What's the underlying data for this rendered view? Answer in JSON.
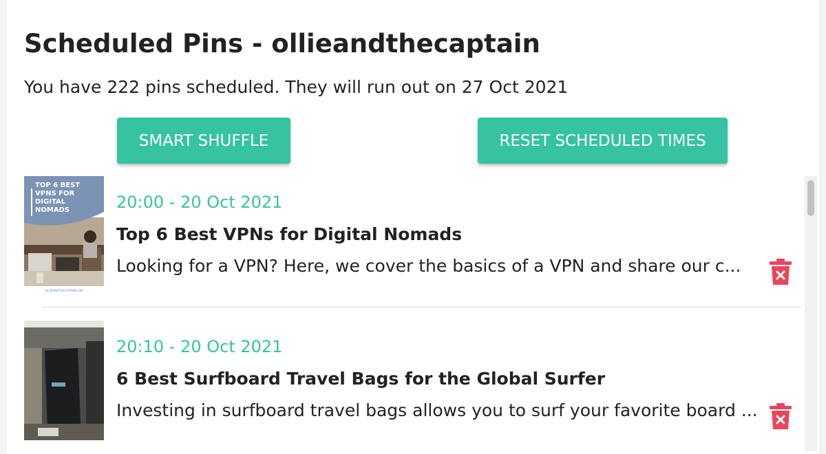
{
  "header": {
    "title": "Scheduled Pins - ollieandthecaptain",
    "subtitle": "You have 222 pins scheduled. They will run out on 27 Oct 2021"
  },
  "actions": {
    "smart_shuffle_label": "SMART SHUFFLE",
    "reset_label": "RESET SCHEDULED TIMES"
  },
  "pins": [
    {
      "time": "20:00 - 20 Oct 2021",
      "title": "Top 6 Best VPNs for Digital Nomads",
      "description": "Looking for a VPN? Here, we cover the basics of a VPN and share our c...",
      "thumbnail": {
        "overlay_lines": [
          "TOP 6 BEST",
          "VPNS FOR",
          "DIGITAL",
          "NOMADS"
        ],
        "footer": "OLLIEANDTHECAPTAIN.COM"
      }
    },
    {
      "time": "20:10 - 20 Oct 2021",
      "title": "6 Best Surfboard Travel Bags for the Global Surfer",
      "description": "Investing in surfboard travel bags allows you to surf your favorite board ..."
    }
  ],
  "colors": {
    "accent": "#36c3a1",
    "delete": "#e8475b",
    "text": "#222222"
  },
  "icons": {
    "delete": "trash-icon"
  }
}
